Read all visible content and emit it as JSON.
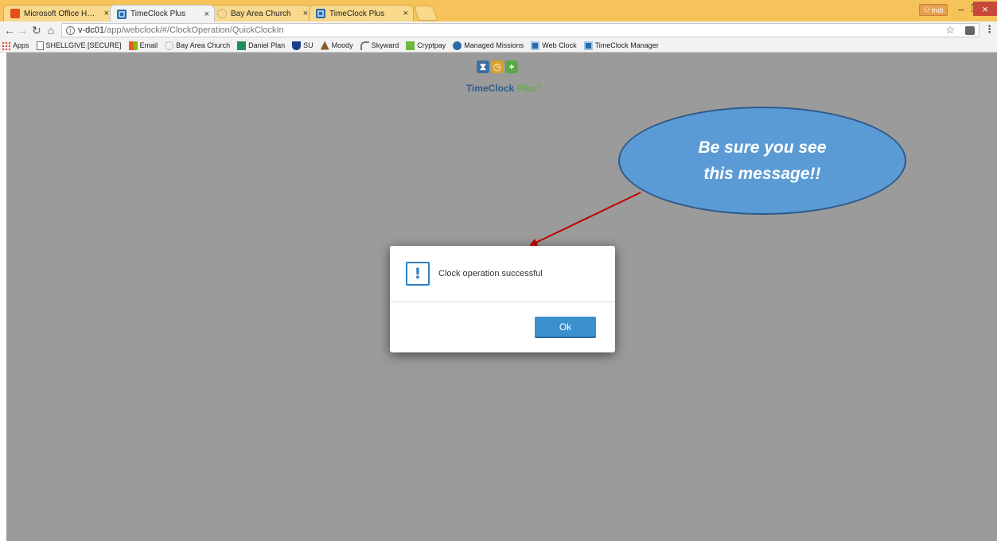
{
  "tabs": [
    {
      "label": "Microsoft Office Home",
      "favicon": "office-icon"
    },
    {
      "label": "TimeClock Plus",
      "favicon": "timeclock-icon"
    },
    {
      "label": "Bay Area Church",
      "favicon": "church-icon"
    },
    {
      "label": "TimeClock Plus",
      "favicon": "timeclock-icon"
    }
  ],
  "tab_close": "×",
  "profile_label": "Indi",
  "window": {
    "minimize": "–",
    "restore": "❐",
    "close": "×"
  },
  "address": {
    "host": "v-dc01",
    "path": "/app/webclock/#/ClockOperation/QuickClockIn"
  },
  "bookmarks": [
    {
      "label": "Apps",
      "icon": "apps-grid-icon"
    },
    {
      "label": "SHELLGIVE [SECURE] ",
      "icon": "page-icon"
    },
    {
      "label": "Email",
      "icon": "microsoft-icon"
    },
    {
      "label": "Bay Area Church",
      "icon": "church-icon"
    },
    {
      "label": "Daniel Plan",
      "icon": "daniel-plan-icon"
    },
    {
      "label": "SU",
      "icon": "su-icon"
    },
    {
      "label": "Moody",
      "icon": "moody-icon"
    },
    {
      "label": "Skyward",
      "icon": "skyward-icon"
    },
    {
      "label": "Cryptpay",
      "icon": "cryptpay-icon"
    },
    {
      "label": "Managed Missions",
      "icon": "managed-missions-icon"
    },
    {
      "label": "Web Clock",
      "icon": "timeclock-icon"
    },
    {
      "label": "TimeClock Manager",
      "icon": "timeclock-icon"
    }
  ],
  "logo": {
    "text_a": "TimeClock ",
    "text_b": "Plus",
    "reg": "®"
  },
  "callout": {
    "text": "Be sure you see this message!!"
  },
  "dialog": {
    "message": "Clock operation successful",
    "ok_label": "Ok",
    "alert_glyph": "!"
  },
  "colors": {
    "page_bg": "#9b9b9b",
    "callout_fill": "#5b9bd5",
    "arrow": "#c00000",
    "ok_button": "#3b8fcc"
  }
}
